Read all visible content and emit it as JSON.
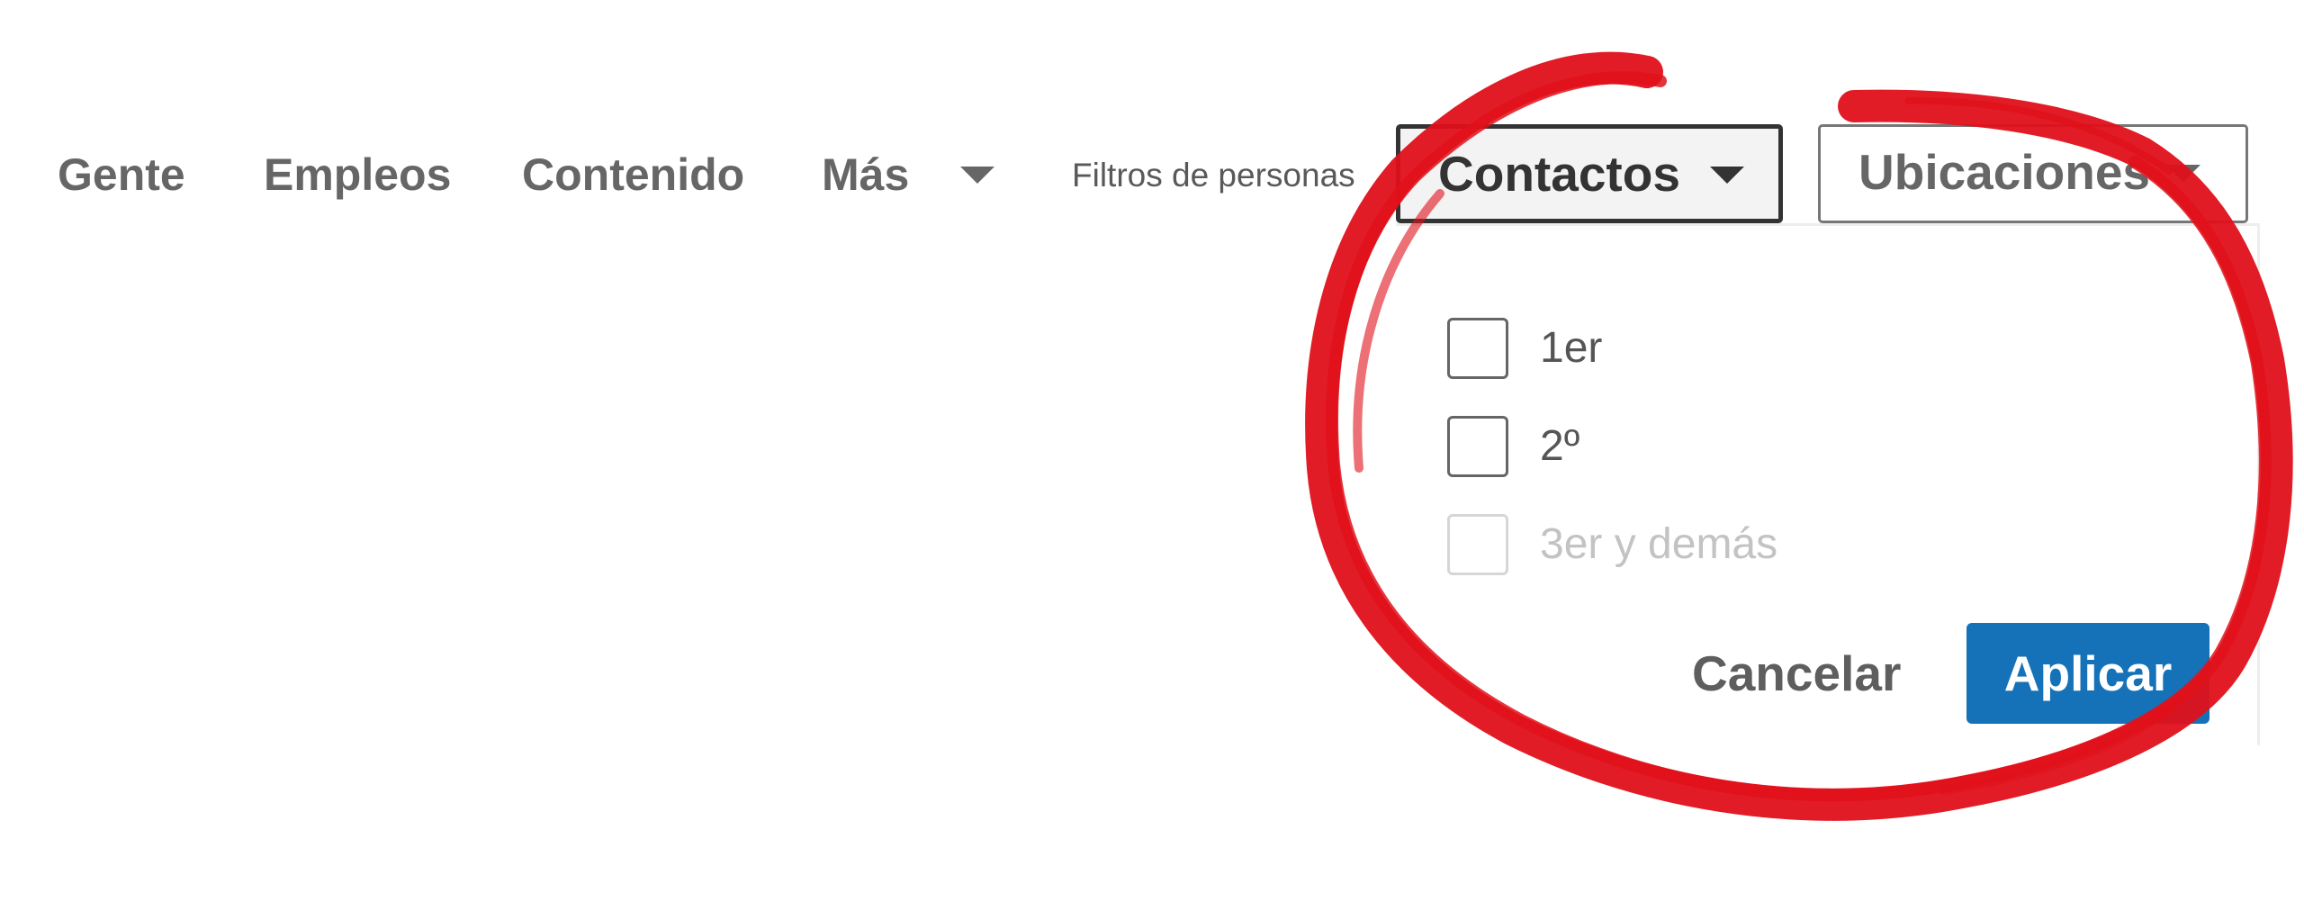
{
  "nav": {
    "items": [
      {
        "label": "Gente"
      },
      {
        "label": "Empleos"
      },
      {
        "label": "Contenido"
      },
      {
        "label": "Más"
      }
    ]
  },
  "filters": {
    "label": "Filtros de personas",
    "contactos": {
      "label": "Contactos",
      "expanded": true
    },
    "ubicaciones": {
      "label": "Ubicaciones",
      "expanded": false
    }
  },
  "dropdown": {
    "options": [
      {
        "label": "1er",
        "checked": false,
        "disabled": false
      },
      {
        "label": "2º",
        "checked": false,
        "disabled": false
      },
      {
        "label": "3er y demás",
        "checked": false,
        "disabled": true
      }
    ],
    "cancel_label": "Cancelar",
    "apply_label": "Aplicar"
  },
  "colors": {
    "accent": "#1572b8",
    "annotation": "#e0101a",
    "text": "#666666"
  },
  "icons": {
    "nav_more": "caret-down-icon",
    "contactos": "caret-down-icon",
    "ubicaciones": "caret-down-icon"
  },
  "annotation": {
    "type": "hand-drawn-circle",
    "target": "contactos-dropdown"
  }
}
